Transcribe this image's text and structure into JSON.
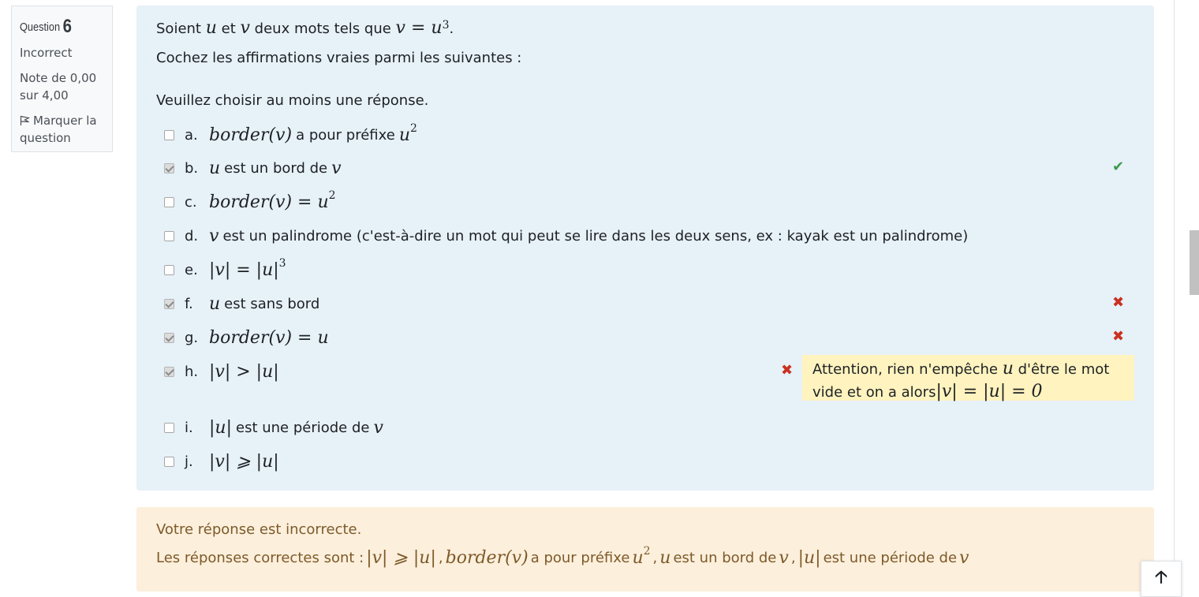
{
  "info": {
    "question_label": "Question",
    "question_number": "6",
    "state": "Incorrect",
    "grade_line1": "Note de 0,00",
    "grade_line2": "sur 4,00",
    "flag_line1": "Marquer la",
    "flag_line2": "question"
  },
  "question": {
    "intro_before": "Soient",
    "intro_var_u": "u",
    "intro_et": "et",
    "intro_var_v": "v",
    "intro_after": "deux mots tels que",
    "intro_formula": "v = u",
    "intro_formula_exp": "3",
    "intro_end": ".",
    "line2": "Cochez les affirmations vraies parmi les suivantes :",
    "prompt": "Veuillez choisir au moins une réponse."
  },
  "options": [
    {
      "letter": "a.",
      "checked": false,
      "math": "border(v)",
      "text": "a pour préfixe",
      "math2": "u",
      "math2_exp": "2"
    },
    {
      "letter": "b.",
      "checked": true,
      "math": "u",
      "text": "est un bord de",
      "math2": "v",
      "mark": "correct"
    },
    {
      "letter": "c.",
      "checked": false,
      "math": "border(v) = u",
      "math_exp": "2"
    },
    {
      "letter": "d.",
      "checked": false,
      "math": "v",
      "text": "est un palindrome (c'est-à-dire un mot qui peut se lire dans les deux sens, ex : kayak est un palindrome)"
    },
    {
      "letter": "e.",
      "checked": false,
      "math": "|v| = |u|",
      "math_exp": "3"
    },
    {
      "letter": "f.",
      "checked": true,
      "math": "u",
      "text": "est sans bord",
      "mark": "incorrect"
    },
    {
      "letter": "g.",
      "checked": true,
      "math": "border(v) = u",
      "mark": "incorrect"
    },
    {
      "letter": "h.",
      "checked": true,
      "math": "|v| > |u|",
      "mark": "incorrect"
    },
    {
      "letter": "i.",
      "checked": false,
      "math": "|u|",
      "text": "est une période de",
      "math2": "v"
    },
    {
      "letter": "j.",
      "checked": false,
      "math": "|v| ⩾ |u|"
    }
  ],
  "feedback_h": {
    "text1": "Attention, rien n'empêche",
    "math1": "u",
    "text2": "d'être le mot",
    "text3": "vide et on a alors",
    "math2": "|v| = |u| = 0"
  },
  "marks": {
    "correct_glyph": "✔",
    "incorrect_glyph": "✖"
  },
  "outcome": {
    "line1": "Votre réponse est incorrecte.",
    "prefix": "Les réponses correctes sont :",
    "ans1": "|v| ⩾ |u|",
    "sep1": ",",
    "ans2_math": "border(v)",
    "ans2_text": "a pour préfixe",
    "ans2_math2": "u",
    "ans2_exp": "2",
    "sep2": ",",
    "ans3_math": "u",
    "ans3_text": "est un bord de",
    "ans3_math2": "v",
    "sep3": ",",
    "ans4_math": "|u|",
    "ans4_text": "est une période de",
    "ans4_math2": "v"
  },
  "back_to_top_glyph": "🡡",
  "colors": {
    "formulation_bg": "#e7f1f8",
    "outcome_bg": "#fcefdc",
    "feedback_bg": "#fff3bf",
    "correct": "#3c9b50",
    "incorrect": "#ca3120"
  }
}
